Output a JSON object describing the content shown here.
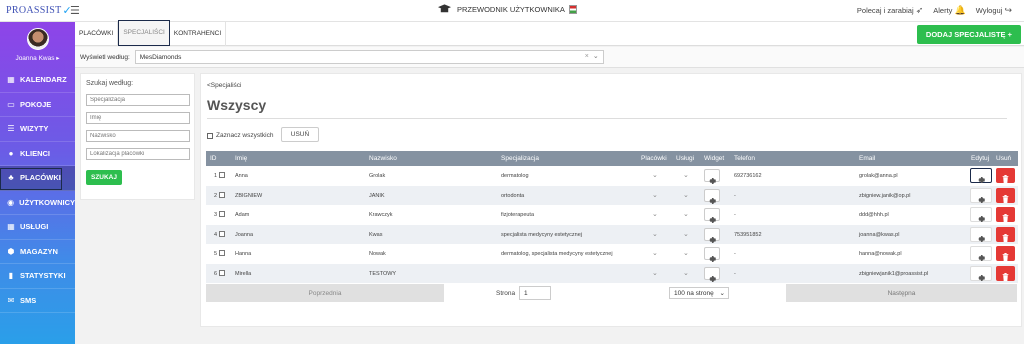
{
  "app": {
    "logo": "PROASSIST",
    "guide": "PRZEWODNIK UŻYTKOWNIKA",
    "recommend": "Polecaj i zarabiaj",
    "alerts": "Alerty",
    "logout": "Wyloguj"
  },
  "user": {
    "name": "Joanna Kwas ▸"
  },
  "nav": [
    {
      "label": "KALENDARZ",
      "icon": "calendar-icon",
      "glyph": "▦"
    },
    {
      "label": "POKOJE",
      "icon": "room-icon",
      "glyph": "▭"
    },
    {
      "label": "WIZYTY",
      "icon": "visits-icon",
      "glyph": "☰"
    },
    {
      "label": "KLIENCI",
      "icon": "clients-icon",
      "glyph": "●"
    },
    {
      "label": "PLACÓWKI",
      "icon": "facility-icon",
      "glyph": "♣"
    },
    {
      "label": "UŻYTKOWNICY",
      "icon": "users-icon",
      "glyph": "◉"
    },
    {
      "label": "USŁUGI",
      "icon": "services-icon",
      "glyph": "▦"
    },
    {
      "label": "MAGAZYN",
      "icon": "warehouse-icon",
      "glyph": "⬢"
    },
    {
      "label": "STATYSTYKI",
      "icon": "stats-icon",
      "glyph": "▮"
    },
    {
      "label": "SMS",
      "icon": "sms-icon",
      "glyph": "✉"
    }
  ],
  "tabs": [
    "PLACÓWKI",
    "SPECJALIŚCI",
    "KONTRAHENCI"
  ],
  "add_button": "DODAJ SPECJALISTĘ +",
  "filter": {
    "label": "Wyświetl według:",
    "value": "MesDiamonds",
    "clear": "×",
    "chevron": "⌄"
  },
  "search": {
    "title": "Szukaj według:",
    "placeholders": [
      "Specjalizacja",
      "Imię",
      "Nazwisko",
      "Lokalizacja placówki"
    ],
    "button": "SZUKAJ"
  },
  "main": {
    "back": "<Specjaliści",
    "title": "Wszyscy",
    "select_all": "Zaznacz wszystkich",
    "delete": "USUŃ"
  },
  "table": {
    "headers": [
      "ID",
      "Imię",
      "Nazwisko",
      "Specjalizacja",
      "Placówki",
      "Usługi",
      "Widget",
      "Telefon",
      "Email",
      "Edytuj",
      "Usuń"
    ],
    "rows": [
      {
        "id": "1",
        "first": "Anna",
        "last": "Grolak",
        "spec": "dermatolog",
        "phone": "692736162",
        "email": "grolak@anna.pl"
      },
      {
        "id": "2",
        "first": "ZBIGNIEW",
        "last": "JANIK",
        "spec": "ortodonta",
        "phone": "-",
        "email": "zbigniew.janik@op.pl"
      },
      {
        "id": "3",
        "first": "Adam",
        "last": "Krawczyk",
        "spec": "fizjoterapeuta",
        "phone": "-",
        "email": "ddd@hhh.pl"
      },
      {
        "id": "4",
        "first": "Joanna",
        "last": "Kwas",
        "spec": "specjalista medycyny estetycznej",
        "phone": "753951852",
        "email": "joanna@kwas.pl"
      },
      {
        "id": "5",
        "first": "Hanna",
        "last": "Nowak",
        "spec": "dermatolog, specjalista medycyny estetycznej",
        "phone": "-",
        "email": "hanna@nowak.pl"
      },
      {
        "id": "6",
        "first": "Mirella",
        "last": "TESTOWY",
        "spec": "",
        "phone": "-",
        "email": "zbigniewjanik1@proassist.pl"
      }
    ]
  },
  "pager": {
    "prev": "Poprzednia",
    "page_label": "Strona",
    "page": "1",
    "per_page": "100 na stronę",
    "next": "Następna"
  }
}
